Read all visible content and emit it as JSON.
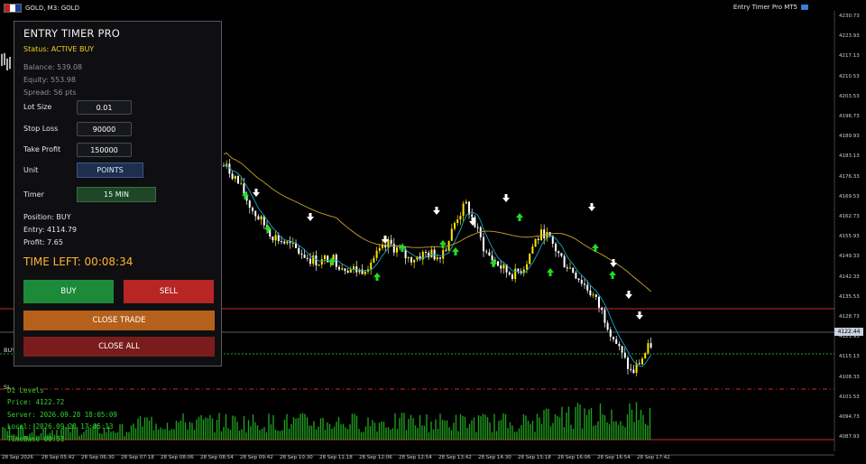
{
  "topbar": {
    "symbol": "GOLD, M3:  GOLD",
    "ea_name": "Entry Timer Pro MT5"
  },
  "panel": {
    "title": "ENTRY TIMER PRO",
    "status": "Status: ACTIVE BUY",
    "balance": "Balance: 539.08",
    "equity": "Equity: 553.98",
    "spread": "Spread: 56 pts",
    "lot_label": "Lot Size",
    "lot_value": "0.01",
    "sl_label": "Stop Loss",
    "sl_value": "90000",
    "tp_label": "Take Profit",
    "tp_value": "150000",
    "unit_label": "Unit",
    "unit_value": "POINTS",
    "timer_label": "Timer",
    "timer_value": "15 MIN",
    "position": "Position: BUY",
    "entry": "Entry: 4114.79",
    "profit": "Profit: 7.65",
    "time_left": "TIME LEFT: 00:08:34",
    "buy": "BUY",
    "sell": "SELL",
    "close_trade": "CLOSE TRADE",
    "close_all": "CLOSE ALL"
  },
  "levels": {
    "title": "D1 Levels",
    "price": "Price: 4122.72",
    "server": "Server: 2026.09.28 18:05:09",
    "local": "Local: 2026.09.28 17:05:13",
    "timebase": "TimeBase 00:51"
  },
  "chart_tags": {
    "buy_tag": "BUY",
    "sl_tag": "SL",
    "current_price": "4122.44"
  },
  "axis": {
    "y": [
      "4230.73",
      "4223.93",
      "4217.13",
      "4210.53",
      "4203.53",
      "4196.73",
      "4189.93",
      "4183.13",
      "4176.33",
      "4169.53",
      "4162.73",
      "4155.93",
      "4149.33",
      "4142.33",
      "4135.53",
      "4128.73",
      "4121.93",
      "4115.13",
      "4108.33",
      "4101.53",
      "4094.73",
      "4087.93"
    ],
    "x": [
      "28 Sep 2026",
      "28 Sep 05:42",
      "28 Sep 06:30",
      "28 Sep 07:18",
      "28 Sep 08:06",
      "28 Sep 08:54",
      "28 Sep 09:42",
      "28 Sep 10:30",
      "28 Sep 11:18",
      "28 Sep 12:06",
      "28 Sep 12:54",
      "28 Sep 13:42",
      "28 Sep 14:30",
      "28 Sep 15:18",
      "28 Sep 16:06",
      "28 Sep 16:54",
      "28 Sep 17:42"
    ]
  },
  "colors": {
    "buy": "#1d8a3a",
    "sell": "#b82525",
    "close": "#b5611b",
    "close_all": "#7a1c1c",
    "levels_text": "#31d331",
    "status": "#f0d020",
    "timer_text": "#ffb52e"
  },
  "chart_data": {
    "type": "line",
    "series": [
      {
        "values": [
          4181,
          4178,
          4172,
          4166,
          4162,
          4158,
          4156,
          4154,
          4152,
          4150,
          4149,
          4151,
          4148,
          4147,
          4146,
          4149,
          4152,
          4155,
          4153,
          4150,
          4151,
          4152,
          4151,
          4155,
          4164,
          4168,
          4160,
          4152,
          4149,
          4146,
          4145,
          4148,
          4156,
          4159,
          4154,
          4149,
          4146,
          4142,
          4138,
          4132,
          4125,
          4118,
          4112,
          4117,
          4122
        ]
      }
    ],
    "ylim": [
      4087.93,
      4230.73
    ]
  }
}
